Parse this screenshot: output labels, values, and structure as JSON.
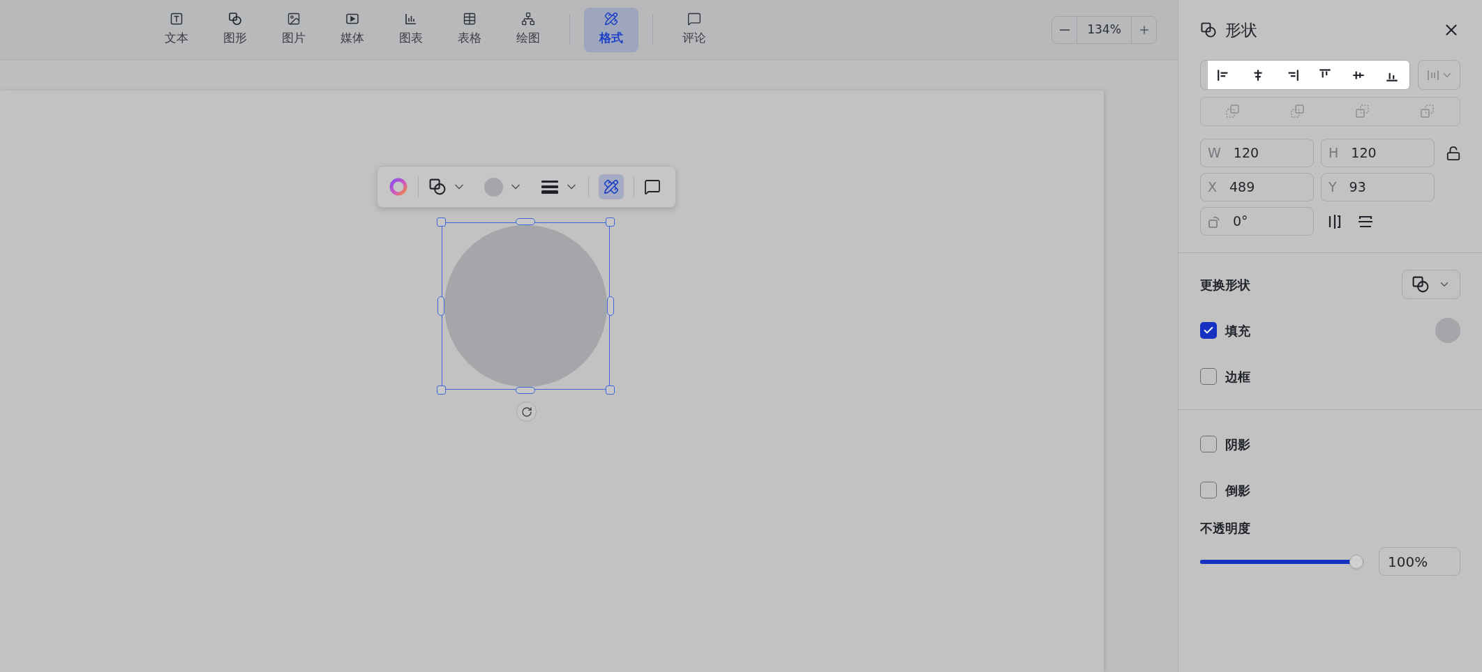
{
  "toolbar": {
    "items": [
      {
        "kind": "text",
        "label": "文本",
        "selected": false
      },
      {
        "kind": "shape",
        "label": "图形",
        "selected": false
      },
      {
        "kind": "image",
        "label": "图片",
        "selected": false
      },
      {
        "kind": "media",
        "label": "媒体",
        "selected": false
      },
      {
        "kind": "chart",
        "label": "图表",
        "selected": false
      },
      {
        "kind": "table",
        "label": "表格",
        "selected": false
      },
      {
        "kind": "diagram",
        "label": "绘图",
        "selected": false
      },
      {
        "kind": "format",
        "label": "格式",
        "selected": true
      },
      {
        "kind": "comment",
        "label": "评论",
        "selected": false
      }
    ]
  },
  "zoom": {
    "value": "134%"
  },
  "panel": {
    "title": "形状",
    "size_fields": [
      {
        "label": "W",
        "value": "120"
      },
      {
        "label": "H",
        "value": "120"
      },
      {
        "label": "X",
        "value": "489"
      },
      {
        "label": "Y",
        "value": "93"
      }
    ],
    "rotation": {
      "value": "0°"
    },
    "change_shape": {
      "label": "更换形状"
    },
    "options": [
      {
        "label": "填充",
        "checked": true,
        "kind": "fill"
      },
      {
        "label": "边框",
        "checked": false,
        "kind": "plain"
      }
    ],
    "effects": [
      {
        "label": "阴影",
        "checked": false
      },
      {
        "label": "倒影",
        "checked": false
      }
    ],
    "opacity": {
      "label": "不透明度",
      "level": 1,
      "value": "100%"
    }
  }
}
